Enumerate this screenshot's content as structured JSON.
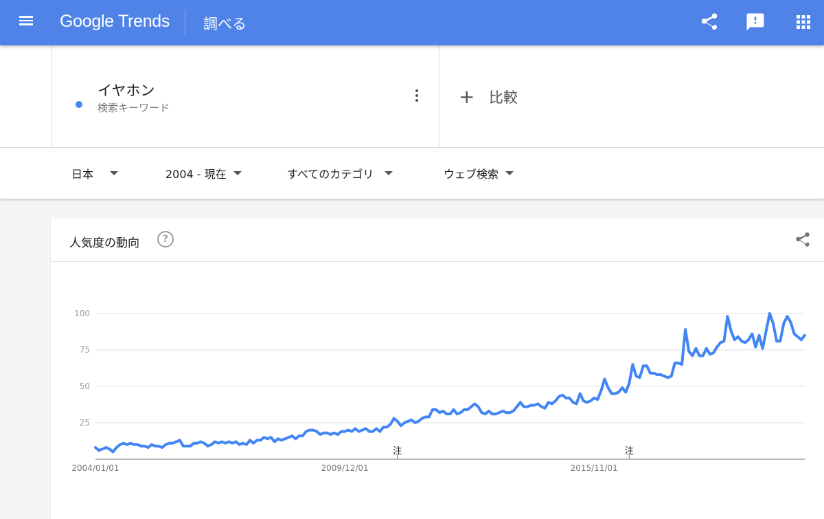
{
  "header": {
    "logo_google": "Google",
    "logo_trends": "Trends",
    "page_name": "調べる",
    "icons": [
      "menu-icon",
      "share-icon",
      "feedback-icon",
      "apps-icon"
    ],
    "color": "#5083e8"
  },
  "term": {
    "title": "イヤホン",
    "subtitle": "検索キーワード",
    "color": "#4285f4",
    "compare_plus": "+",
    "compare_label": "比較"
  },
  "filters": [
    {
      "label": "日本"
    },
    {
      "label": "2004 - 現在"
    },
    {
      "label": "すべてのカテゴリ"
    },
    {
      "label": "ウェブ検索"
    }
  ],
  "card": {
    "title": "人気度の動向",
    "help": "?"
  },
  "chart_data": {
    "type": "line",
    "series": [
      {
        "color": "#4285f4",
        "values": [
          8,
          6,
          7,
          8,
          7,
          5,
          8,
          10,
          11,
          10,
          11,
          10,
          10,
          9,
          9,
          8,
          10,
          9,
          9,
          8,
          10,
          11,
          11,
          12,
          13,
          9,
          9,
          9,
          11,
          11,
          12,
          11,
          9,
          10,
          12,
          11,
          12,
          11,
          12,
          11,
          12,
          10,
          11,
          10,
          13,
          11,
          13,
          13,
          15,
          14,
          15,
          12,
          14,
          13,
          14,
          15,
          16,
          14,
          16,
          16,
          19,
          20,
          20,
          19,
          17,
          18,
          18,
          17,
          18,
          17,
          19,
          19,
          20,
          19,
          21,
          19,
          20,
          21,
          19,
          19,
          21,
          19,
          22,
          22,
          24,
          28,
          26,
          23,
          25,
          26,
          27,
          25,
          26,
          28,
          29,
          29,
          34,
          34,
          32,
          33,
          31,
          31,
          34,
          31,
          32,
          34,
          34,
          36,
          38,
          36,
          32,
          31,
          33,
          31,
          31,
          32,
          33,
          32,
          32,
          33,
          36,
          39,
          36,
          36,
          37,
          37,
          38,
          36,
          35,
          39,
          38,
          40,
          43,
          44,
          42,
          42,
          39,
          38,
          45,
          40,
          39,
          40,
          42,
          41,
          47,
          55,
          49,
          45,
          45,
          46,
          49,
          46,
          52,
          65,
          57,
          56,
          64,
          64,
          59,
          59,
          58,
          58,
          57,
          56,
          57,
          66,
          66,
          65,
          89,
          74,
          71,
          76,
          71,
          71,
          76,
          72,
          73,
          77,
          80,
          81,
          98,
          88,
          82,
          84,
          81,
          80,
          82,
          86,
          77,
          85,
          76,
          88,
          100,
          93,
          81,
          81,
          93,
          98,
          94,
          86,
          84,
          82,
          85
        ]
      }
    ],
    "x_range": [
      "2004/01",
      "2019/09"
    ],
    "ylim": [
      0,
      100
    ],
    "y_ticks": [
      100,
      75,
      50,
      25
    ],
    "x_tick_labels": [
      {
        "label": "2004/01/01",
        "index": 0
      },
      {
        "label": "2009/12/01",
        "index": 71
      },
      {
        "label": "2015/11/01",
        "index": 142
      }
    ],
    "notes": [
      {
        "label": "注",
        "index": 86
      },
      {
        "label": "注",
        "index": 152
      }
    ],
    "grid": true
  }
}
